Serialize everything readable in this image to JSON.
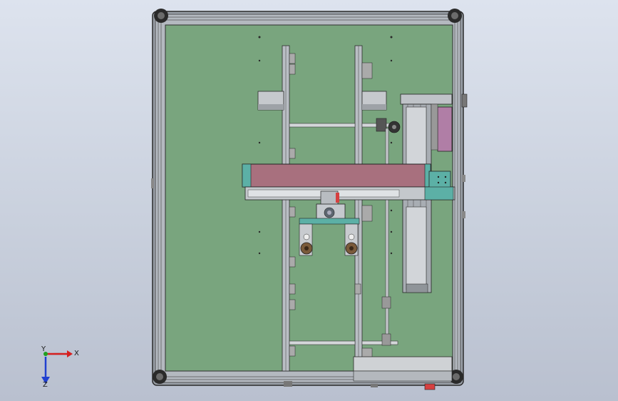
{
  "viewport": {
    "background_top": "#dde3ee",
    "background_bottom": "#b9c0cf"
  },
  "model": {
    "plate_color": "#79a57e",
    "frame_color": "#a3a8b0",
    "frame_edge_color": "#2b2b2b",
    "beam_color": "#a8707e",
    "teal_part_color": "#5cb0a6",
    "magenta_part_color": "#b07ea6",
    "wheel_color": "#7a5a3a",
    "red_part_color": "#d64040"
  },
  "triad": {
    "x_label": "X",
    "y_label": "Y",
    "z_label": "Z",
    "x_color": "#d62020",
    "y_color": "#20a020",
    "z_color": "#2040d0"
  }
}
